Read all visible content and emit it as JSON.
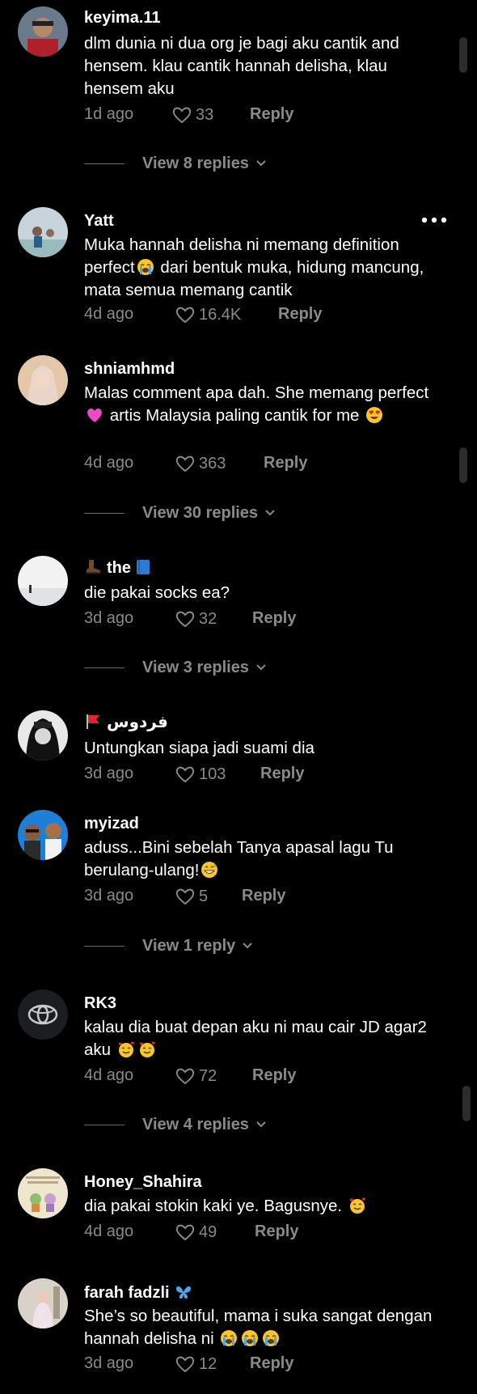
{
  "comments": [
    {
      "username": "keyima.11",
      "text": "dlm dunia ni dua org je bagi aku cantik and hensem. klau cantik hannah delisha, klau hensem aku",
      "time": "1d ago",
      "likes": "33",
      "reply": "Reply",
      "view_replies": "View 8 replies"
    },
    {
      "username": "Yatt",
      "text_parts": [
        "Muka hannah delisha ni memang definition perfect",
        " dari bentuk muka, hidung mancung, mata semua memang cantik"
      ],
      "time": "4d ago",
      "likes": "16.4K",
      "reply": "Reply"
    },
    {
      "username": "shniamhmd",
      "text_parts": [
        "Malas comment apa dah. She memang perfect ",
        " artis Malaysia paling cantik for me "
      ],
      "time": "4d ago",
      "likes": "363",
      "reply": "Reply",
      "view_replies": "View 30 replies"
    },
    {
      "username": "the",
      "text": "die pakai socks ea?",
      "time": "3d ago",
      "likes": "32",
      "reply": "Reply",
      "view_replies": "View 3 replies"
    },
    {
      "username": "فردوس",
      "text": "Untungkan siapa jadi suami dia",
      "time": "3d ago",
      "likes": "103",
      "reply": "Reply"
    },
    {
      "username": "myizad",
      "text_parts": [
        "aduss...Bini sebelah Tanya apasal lagu Tu berulang-ulang!"
      ],
      "time": "3d ago",
      "likes": "5",
      "reply": "Reply",
      "view_replies": "View 1 reply"
    },
    {
      "username": "RK3",
      "text_parts": [
        "kalau dia buat depan aku ni mau cair JD agar2 aku "
      ],
      "time": "4d ago",
      "likes": "72",
      "reply": "Reply",
      "view_replies": "View 4 replies"
    },
    {
      "username": "Honey_Shahira",
      "text_parts": [
        "dia pakai stokin kaki ye. Bagusnye. "
      ],
      "time": "4d ago",
      "likes": "49",
      "reply": "Reply"
    },
    {
      "username": "farah fadzli",
      "text_parts": [
        "She’s so beautiful, mama i suka sangat dengan hannah delisha ni "
      ],
      "time": "3d ago",
      "likes": "12",
      "reply": "Reply"
    }
  ],
  "icons": {
    "like": "heart-outline-icon",
    "expand": "chevron-down-icon",
    "more": "more-options-icon"
  },
  "colors": {
    "background": "#000000",
    "primary_text": "#ffffff",
    "secondary_text": "#8a8a8a"
  }
}
